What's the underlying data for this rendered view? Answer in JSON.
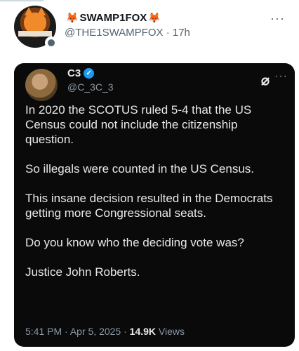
{
  "post": {
    "display_name": "SWAMP1FOX",
    "handle": "@THE1SWAMPFOX",
    "separator": "·",
    "time": "17h",
    "more_icon": "more-horizontal-icon"
  },
  "quoted": {
    "display_name": "C3",
    "handle": "@C_3C_3",
    "paragraphs": [
      "In 2020 the SCOTUS ruled 5-4 that the US Census could not include the citizenship question.",
      "So illegals were counted in the US Census.",
      "This insane decision resulted in the Democrats getting more Congressional seats.",
      "Do you know who the deciding vote was?",
      "Justice John Roberts."
    ],
    "time": "5:41 PM",
    "date": "Apr 5, 2025",
    "views_count": "14.9K",
    "views_label": "Views",
    "meta_separator": "·"
  },
  "colors": {
    "card_background": "#0a0a0a",
    "verified": "#1d9bf0",
    "fox_emoji": "#f07a1a"
  }
}
